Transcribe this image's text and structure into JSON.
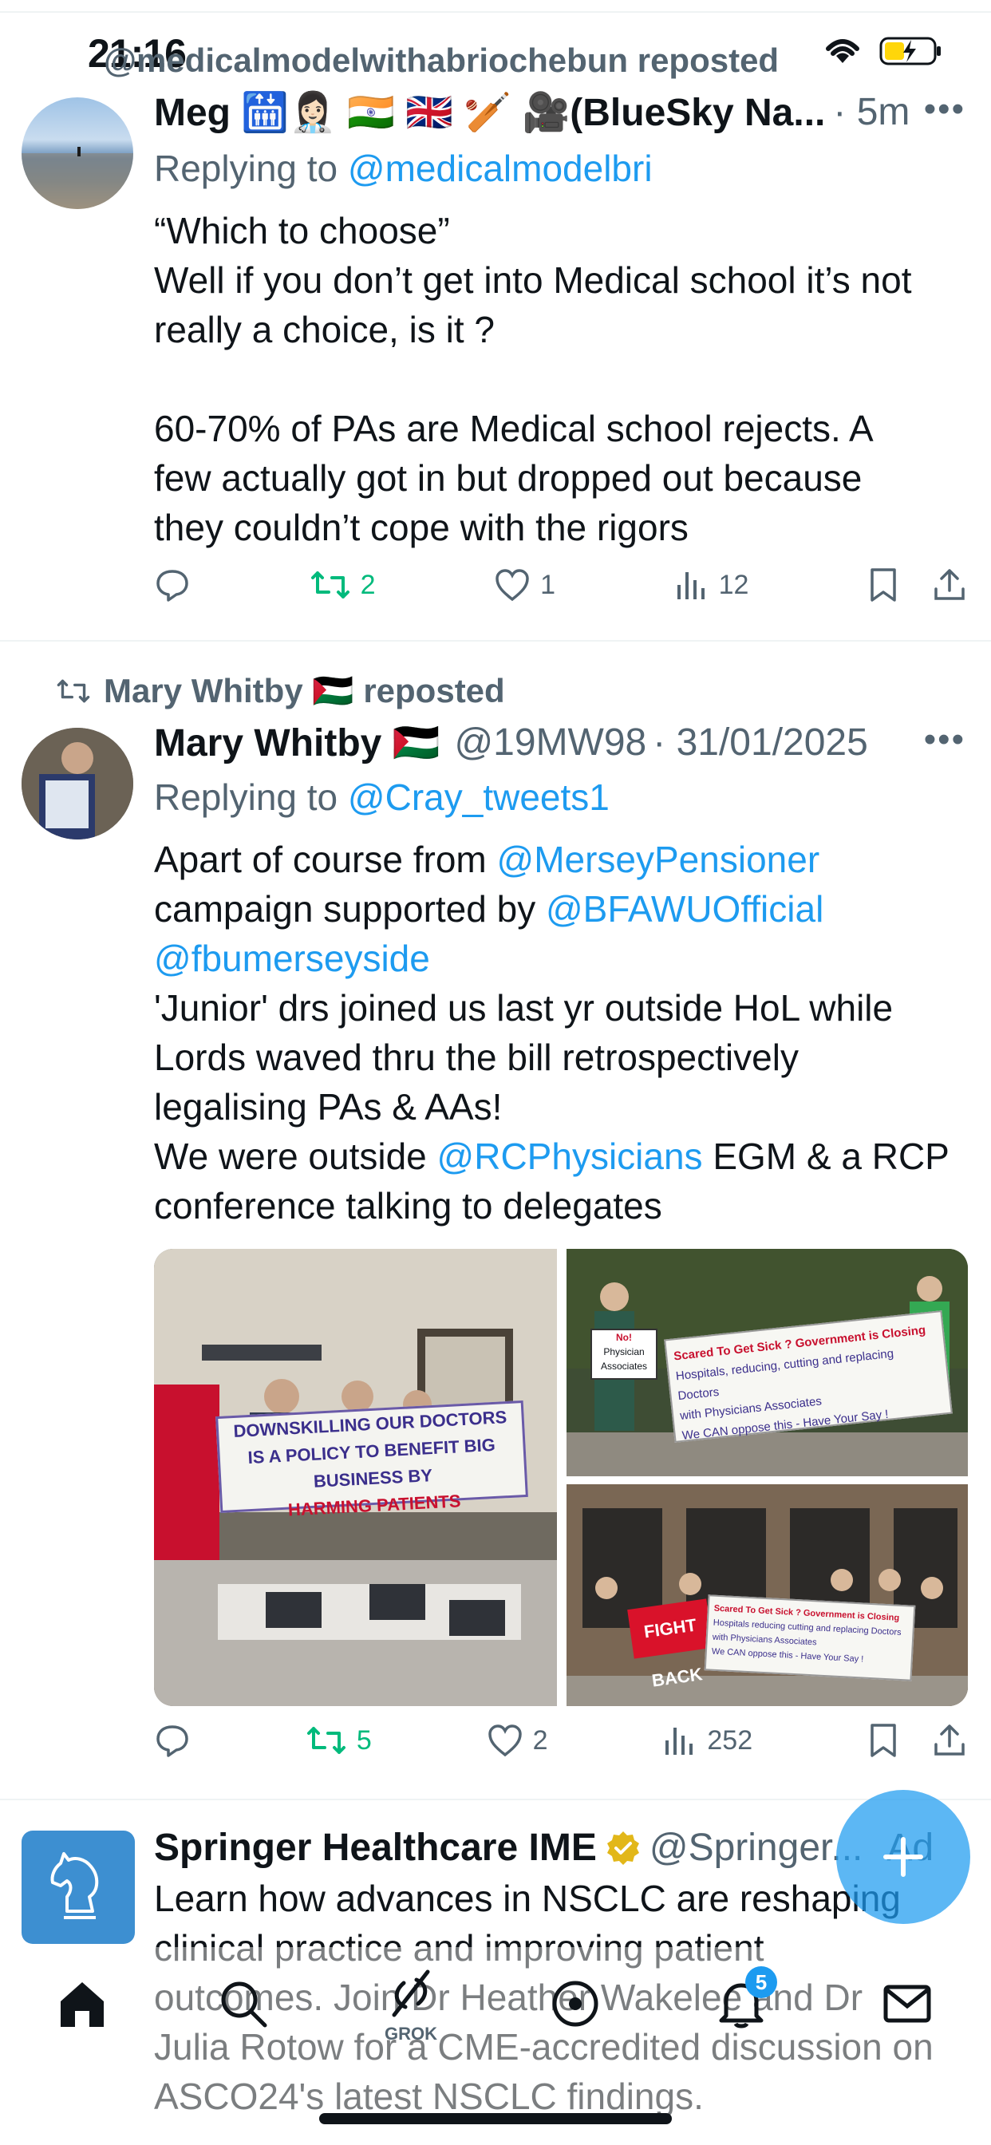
{
  "status_bar": {
    "time": "21:16"
  },
  "tweet1": {
    "repost_text": "@medicalmodelwithabriochebun reposted",
    "name": "Meg 🛗👩🏻‍⚕️ 🇮🇳 🇬🇧 🏏 🎥(BlueSky Na...",
    "meta": "· 5m",
    "reply_prefix": "Replying to",
    "reply_handle": "@medicalmodelbri",
    "body_lines": [
      "“Which to choose”",
      "Well if you don’t get into Medical school it’s not",
      "really a choice, is it ?",
      "",
      "60-70% of PAs are Medical school rejects. A",
      "few actually got in but dropped out because",
      "they couldn’t cope with the rigors"
    ],
    "retweets": "2",
    "likes": "1",
    "views": "12"
  },
  "tweet2": {
    "repost_text": "Mary Whitby 🇵🇸 reposted",
    "name": "Mary Whitby 🇵🇸",
    "handle": "@19MW98",
    "date": "· 31/01/2025",
    "reply_prefix": "Replying to",
    "reply_handle": "@Cray_tweets1",
    "line1_text": "Apart of course from ",
    "line1_link": "@MerseyPensioner",
    "line2_text": "campaign supported by ",
    "line2_link": "@BFAWUOfficial",
    "line3_link": "@fbumerseyside",
    "line4": "'Junior' drs joined us last yr outside HoL while",
    "line5": "Lords waved thru the bill retrospectively",
    "line6": "legalising PAs & AAs!",
    "line7_text": "We were outside ",
    "line7_link": "@RCPhysicians",
    "line7_tail": " EGM & a RCP",
    "line8": "conference talking to delegates",
    "photo1_banner": [
      "DOWNSKILLING OUR DOCTORS",
      "IS A POLICY TO BENEFIT BIG BUSINESS BY",
      "HARMING PATIENTS"
    ],
    "photo2_banner": [
      "Scared To Get Sick ? Government is Closing",
      "Hospitals, reducing, cutting and replacing Doctors",
      "with Physicians Associates",
      "We CAN oppose this - Have Your Say !"
    ],
    "photo2_sign": [
      "No!",
      "Physician",
      "Associates"
    ],
    "photo3_banner_left": "FIGHT BACK",
    "photo3_banner_right": [
      "Scared To Get Sick ? Government is Closing",
      "Hospitals reducing cutting and replacing Doctors",
      "with Physicians Associates",
      "We CAN oppose this - Have Your Say !"
    ],
    "retweets": "5",
    "likes": "2",
    "views": "252"
  },
  "tweet3": {
    "name": "Springer Healthcare IME",
    "handle": "@Springer...",
    "ad_label": "Ad",
    "body_lines": [
      "Learn how advances in NSCLC are reshaping",
      "clinical practice and improving patient",
      "outcomes. Join Dr Heather Wakelee and Dr",
      "Julia Rotow for a CME-accredited discussion on",
      "ASCO24's latest NSCLC findings."
    ]
  },
  "bottom_nav": {
    "grok_label": "GROK",
    "notification_count": "5"
  },
  "colors": {
    "accent": "#1d9bf0",
    "retweet": "#00ba7c",
    "muted": "#536471",
    "text": "#0f1419"
  }
}
